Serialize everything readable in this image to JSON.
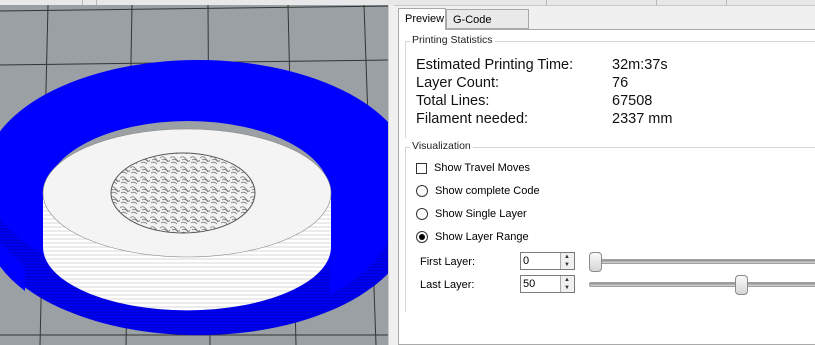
{
  "tabs": [
    {
      "label": "Preview",
      "active": true
    },
    {
      "label": "G-Code Editor",
      "active": false
    }
  ],
  "printing_statistics": {
    "title": "Printing Statistics",
    "rows": [
      {
        "label": "Estimated Printing Time:",
        "value": "32m:37s"
      },
      {
        "label": "Layer Count:",
        "value": "76"
      },
      {
        "label": "Total Lines:",
        "value": "67508"
      },
      {
        "label": "Filament needed:",
        "value": "2337 mm"
      }
    ]
  },
  "visualization": {
    "title": "Visualization",
    "show_travel_moves": {
      "label": "Show Travel Moves",
      "checked": false
    },
    "options": [
      {
        "label": "Show complete Code",
        "selected": false
      },
      {
        "label": "Show Single Layer",
        "selected": false
      },
      {
        "label": "Show Layer Range",
        "selected": true
      }
    ],
    "first_layer": {
      "label": "First Layer:",
      "value": "0",
      "slider_fraction": 0.0
    },
    "last_layer": {
      "label": "Last Layer:",
      "value": "50",
      "slider_fraction": 0.66
    }
  },
  "colors": {
    "model_blue": "#0000f0",
    "grid_background": "#9aa0a3",
    "selected_tab": "#ffffff"
  }
}
